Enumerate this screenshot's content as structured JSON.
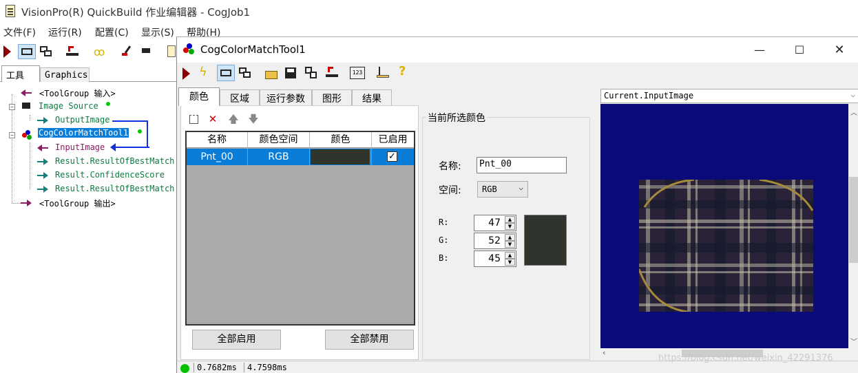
{
  "qb": {
    "title": "VisionPro(R) QuickBuild 作业编辑器 - CogJob1",
    "menu": [
      "文件(F)",
      "运行(R)",
      "配置(C)",
      "显示(S)",
      "帮助(H)"
    ],
    "tabs": [
      "工具",
      "Graphics"
    ],
    "tree": {
      "input_group": "<ToolGroup 输入>",
      "image_source": "Image Source",
      "output_image": "OutputImage",
      "match_tool": "CogColorMatchTool1",
      "input_image": "InputImage",
      "result1": "Result.ResultOfBestMatch",
      "confidence": "Result.ConfidenceScore",
      "result2": "Result.ResultOfBestMatch",
      "output_group": "<ToolGroup 输出>"
    }
  },
  "dialog": {
    "title": "CogColorMatchTool1",
    "tabs": [
      "颜色",
      "区域",
      "运行参数",
      "图形",
      "结果"
    ],
    "table": {
      "headers": [
        "名称",
        "颜色空间",
        "颜色",
        "已启用"
      ],
      "rows": [
        {
          "name": "Pnt_00",
          "space": "RGB",
          "color": "#2f342d",
          "enabled": true
        }
      ]
    },
    "buttons": {
      "enable_all": "全部启用",
      "disable_all": "全部禁用"
    },
    "current": {
      "group_label": "当前所选颜色",
      "name_label": "名称:",
      "name_value": "Pnt_00",
      "space_label": "空间:",
      "space_value": "RGB",
      "r_label": "R:",
      "g_label": "G:",
      "b_label": "B:",
      "r": "47",
      "g": "52",
      "b": "45",
      "swatch": "#2f342d"
    },
    "image_selector": "Current.InputImage",
    "status": {
      "time1": "0.7682ms",
      "time2": "4.7598ms"
    }
  },
  "watermark": "https://blog.csdn.net/weixin_42291376",
  "colors": {
    "selection": "#0a7dd8",
    "canvas": "#0a0a7a",
    "link_blue": "#1030e0",
    "status_ok": "#00c000"
  }
}
